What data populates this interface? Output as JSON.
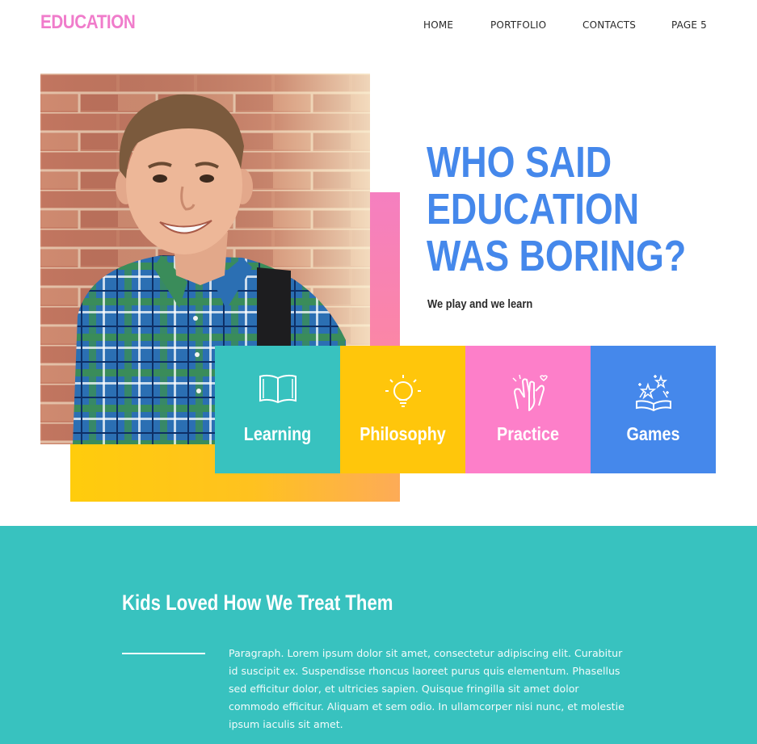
{
  "brand": {
    "logo_text": "EDUCATION",
    "accent_pink": "#f07ccb",
    "accent_blue": "#4588eb"
  },
  "nav": {
    "items": [
      {
        "label": "HOME"
      },
      {
        "label": "PORTFOLIO"
      },
      {
        "label": "CONTACTS"
      },
      {
        "label": "PAGE 5"
      }
    ]
  },
  "hero": {
    "headline_lines": [
      "WHO SAID",
      "EDUCATION",
      "WAS BORING?"
    ],
    "tagline": "We play and we learn",
    "photo_icon": "boy-with-backpack-photo"
  },
  "features": [
    {
      "label": "Learning",
      "icon": "open-book-icon",
      "color": "#38c2bf"
    },
    {
      "label": "Philosophy",
      "icon": "lightbulb-icon",
      "color": "#ffc60b"
    },
    {
      "label": "Practice",
      "icon": "clapping-hands-icon",
      "color": "#fd7fc9"
    },
    {
      "label": "Games",
      "icon": "magic-book-icon",
      "color": "#4588eb"
    }
  ],
  "section": {
    "title": "Kids Loved How We Treat Them",
    "paragraph": "Paragraph. Lorem ipsum dolor sit amet, consectetur adipiscing elit. Curabitur id suscipit ex. Suspendisse rhoncus laoreet purus quis elementum. Phasellus sed efficitur dolor, et ultricies sapien. Quisque fringilla sit amet dolor commodo efficitur. Aliquam et sem odio. In ullamcorper nisi nunc, et molestie ipsum iaculis sit amet.",
    "background": "#38c2bf"
  }
}
